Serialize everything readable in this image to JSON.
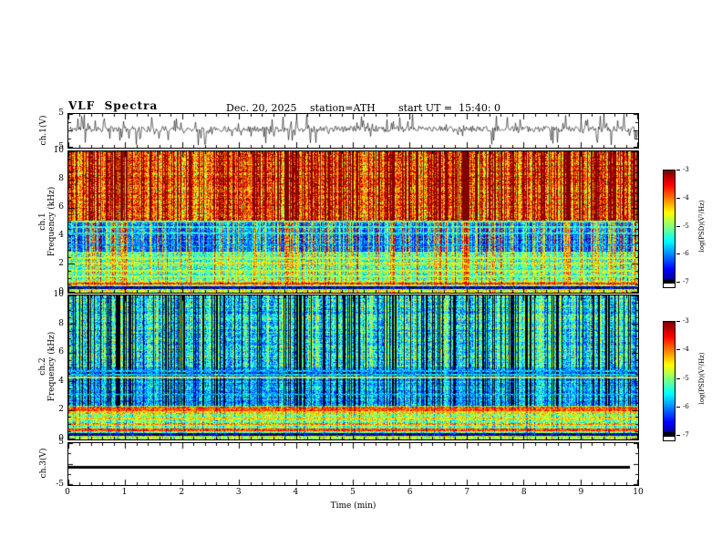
{
  "header": {
    "title": "VLF  Spectra",
    "date": "Dec. 20, 2025",
    "station": "station=ATH",
    "start_ut": "start UT =  15:40: 0"
  },
  "xaxis": {
    "label": "Time (min)",
    "range": [
      0,
      10
    ],
    "ticks": [
      0,
      1,
      2,
      3,
      4,
      5,
      6,
      7,
      8,
      9,
      10
    ]
  },
  "chart_data": [
    {
      "id": "ch1wave",
      "type": "line",
      "ylabel": "ch.1(V)",
      "ylim": [
        -5,
        5
      ],
      "yticks": [
        5,
        -5
      ],
      "baseline": 0.4,
      "noise": 0.9,
      "spike_prob": 0.16,
      "spike_min": 1.2,
      "spike_max": 3.2,
      "seed": 11
    },
    {
      "id": "ch1spec",
      "type": "heatmap",
      "ylabel_lines": [
        "ch.1",
        "Frequency (kHz)"
      ],
      "ylim": [
        0,
        10
      ],
      "yticks": [
        0,
        2,
        4,
        6,
        8,
        10
      ],
      "vrange": [
        -7,
        -3
      ],
      "seed": 2024,
      "stripe": {
        "base": 0.85,
        "prob": 0.3,
        "amp": [
          0.9,
          1.4
        ]
      },
      "bands": [
        {
          "f": [
            5.1,
            10.01
          ],
          "base": -4.55,
          "gain": 1.5,
          "noise": 0.75
        },
        {
          "f": [
            2.9,
            5.1
          ],
          "base": -6.5,
          "gain": 1.15,
          "noise": 0.55
        },
        {
          "f": [
            0.9,
            2.9
          ],
          "base": -5.45,
          "gain": 0.65,
          "noise": 0.6
        },
        {
          "f": [
            0,
            0.9
          ],
          "base": -4.95,
          "gain": 0.35,
          "noise": 0.75
        }
      ],
      "hlines": [
        {
          "f": 5.02,
          "w": 0.06,
          "v": -5.3
        },
        {
          "f": 4.62,
          "w": 0.06,
          "v": -5.45
        },
        {
          "f": 4.18,
          "w": 0.05,
          "v": -5.6
        },
        {
          "f": 3.4,
          "w": 0.04,
          "v": -6.0
        },
        {
          "f": 2.45,
          "w": 0.05,
          "v": -4.9
        },
        {
          "f": 2.05,
          "w": 0.07,
          "v": -4.7
        },
        {
          "f": 1.55,
          "w": 0.06,
          "v": -4.9
        },
        {
          "f": 1.15,
          "w": 0.05,
          "v": -5.0
        },
        {
          "f": 0.62,
          "w": 0.09,
          "v": -3.8
        },
        {
          "f": 0.34,
          "w": 0.09,
          "v": -6.85
        },
        {
          "f": 0.12,
          "w": 0.07,
          "v": -4.7
        }
      ],
      "colorbar": {
        "label": "log(PSD)(V²/Hz)",
        "ticks": [
          -3,
          -4,
          -5,
          -6,
          -7
        ],
        "range": [
          -7,
          -3
        ]
      }
    },
    {
      "id": "ch2spec",
      "type": "heatmap",
      "ylabel_lines": [
        "ch.2",
        "Frequency (kHz)"
      ],
      "ylim": [
        0,
        10
      ],
      "yticks": [
        0,
        2,
        4,
        6,
        8,
        10
      ],
      "vrange": [
        -7,
        -3
      ],
      "seed": 777,
      "stripe": {
        "base": 0.7,
        "prob": 0.25,
        "amp": [
          1.0,
          1.5
        ]
      },
      "bands": [
        {
          "f": [
            5.0,
            10.01
          ],
          "base": -4.85,
          "gain": -1.7,
          "noise": 0.7
        },
        {
          "f": [
            4.1,
            5.0
          ],
          "base": -5.6,
          "gain": -0.9,
          "noise": 0.5
        },
        {
          "f": [
            2.35,
            4.1
          ],
          "base": -5.35,
          "gain": -1.0,
          "noise": 0.6
        },
        {
          "f": [
            0,
            2.35
          ],
          "base": -4.75,
          "gain": -0.35,
          "noise": 0.7
        }
      ],
      "hlines": [
        {
          "f": 4.75,
          "w": 0.05,
          "v": -5.9
        },
        {
          "f": 4.5,
          "w": 0.05,
          "v": -5.8
        },
        {
          "f": 4.32,
          "w": 0.06,
          "v": -4.7
        },
        {
          "f": 3.1,
          "w": 0.04,
          "v": -5.9
        },
        {
          "f": 2.1,
          "w": 0.13,
          "v": -3.9
        },
        {
          "f": 1.8,
          "w": 0.08,
          "v": -4.4
        },
        {
          "f": 1.45,
          "w": 0.07,
          "v": -4.5
        },
        {
          "f": 1.05,
          "w": 0.08,
          "v": -4.2
        },
        {
          "f": 0.65,
          "w": 0.09,
          "v": -3.8
        },
        {
          "f": 0.3,
          "w": 0.1,
          "v": -6.85
        },
        {
          "f": 0.1,
          "w": 0.07,
          "v": -4.6
        }
      ],
      "colorbar": {
        "label": "log(PSD)(V²/Hz)",
        "ticks": [
          -3,
          -4,
          -5,
          -6,
          -7
        ],
        "range": [
          -7,
          -3
        ]
      }
    },
    {
      "id": "ch3wave",
      "type": "line",
      "ylabel": "ch.3(V)",
      "ylim": [
        -5,
        5
      ],
      "yticks": [
        5,
        -5
      ],
      "flat_value": -0.7,
      "seed": 404
    }
  ]
}
